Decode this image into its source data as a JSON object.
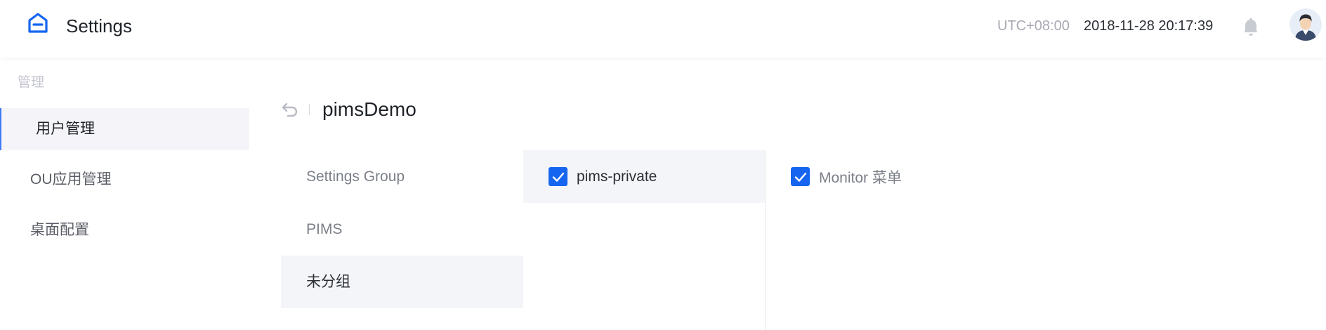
{
  "header": {
    "title": "Settings",
    "timezone": "UTC+08:00",
    "datetime": "2018-11-28 20:17:39",
    "icons": {
      "logo": "home-logo-icon",
      "notifications": "bell-icon",
      "avatar": "user-avatar"
    }
  },
  "sidebar": {
    "section_label": "管理",
    "items": [
      {
        "label": "用户管理",
        "active": true
      },
      {
        "label": "OU应用管理",
        "active": false
      },
      {
        "label": "桌面配置",
        "active": false
      }
    ]
  },
  "main": {
    "back_icon": "undo-arrow-icon",
    "title": "pimsDemo",
    "groups": [
      {
        "label": "Settings Group",
        "active": false
      },
      {
        "label": "PIMS",
        "active": false
      },
      {
        "label": "未分组",
        "active": true
      }
    ],
    "apps": [
      {
        "label": "pims-private",
        "checked": true
      }
    ],
    "permissions": [
      {
        "label": "Monitor 菜单",
        "checked": true
      }
    ]
  },
  "colors": {
    "accent": "#1565f0",
    "active_border": "#3c7bf3",
    "active_bg": "#f4f5f9",
    "muted_text": "#a8a9b3"
  }
}
